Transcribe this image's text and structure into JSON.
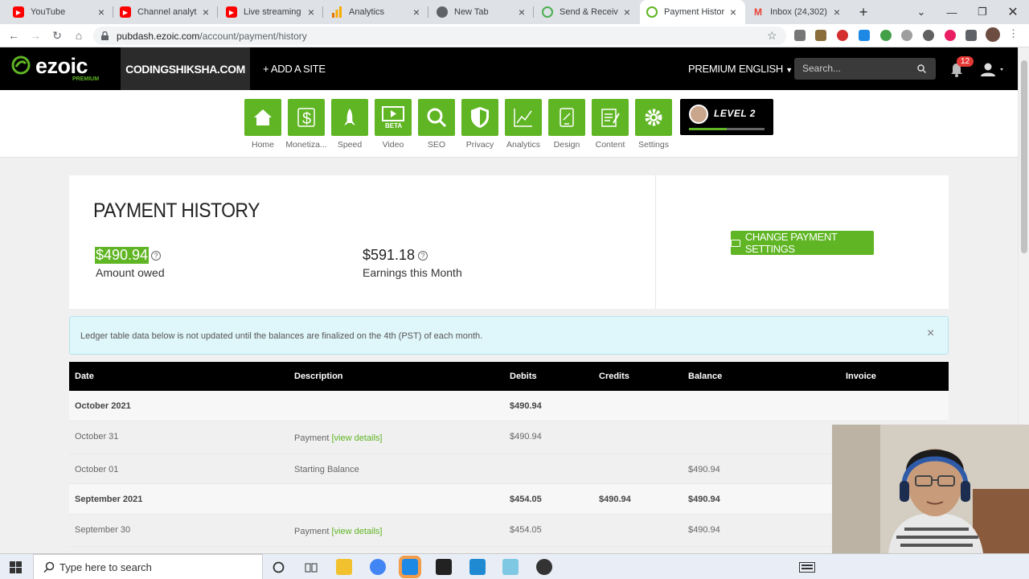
{
  "browser": {
    "tabs": [
      {
        "title": "YouTube",
        "favicon": "youtube-icon",
        "color": "#ff0000"
      },
      {
        "title": "Channel analytics",
        "favicon": "youtube-icon",
        "color": "#ff0000"
      },
      {
        "title": "Live streaming -",
        "favicon": "youtube-icon",
        "color": "#ff0000"
      },
      {
        "title": "Analytics",
        "favicon": "analytics-icon",
        "color": "#f9ab00"
      },
      {
        "title": "New Tab",
        "favicon": "chrome-icon",
        "color": "#5f6368"
      },
      {
        "title": "Send & Receive",
        "favicon": "circle-icon",
        "color": "#4caf50"
      },
      {
        "title": "Payment History",
        "favicon": "ezoic-icon",
        "color": "#5fb523"
      },
      {
        "title": "Inbox (24,302) -",
        "favicon": "gmail-icon",
        "color": "#ea4335"
      }
    ],
    "new_tab": "+",
    "url_domain": "pubdash.ezoic.com",
    "url_path": "/account/payment/history"
  },
  "header": {
    "logo": "ezoic",
    "logo_sub": "PREMIUM",
    "site": "CODINGSHIKSHA.COM",
    "add_site": "+ ADD A SITE",
    "premium": "PREMIUM",
    "language": "ENGLISH",
    "search_placeholder": "Search...",
    "notification_count": "12"
  },
  "nav": [
    {
      "label": "Home",
      "icon": "home-icon"
    },
    {
      "label": "Monetiza...",
      "icon": "dollar-icon"
    },
    {
      "label": "Speed",
      "icon": "rocket-icon"
    },
    {
      "label": "Video",
      "icon": "video-icon",
      "badge": "BETA"
    },
    {
      "label": "SEO",
      "icon": "magnifier-icon"
    },
    {
      "label": "Privacy",
      "icon": "shield-icon"
    },
    {
      "label": "Analytics",
      "icon": "chart-icon"
    },
    {
      "label": "Design",
      "icon": "design-icon"
    },
    {
      "label": "Content",
      "icon": "content-icon"
    },
    {
      "label": "Settings",
      "icon": "gear-icon"
    }
  ],
  "level": {
    "label": "LEVEL 2",
    "progress": 0.5
  },
  "summary": {
    "title": "PAYMENT HISTORY",
    "owed_value": "$490.94",
    "owed_label": "Amount owed",
    "earnings_value": "$591.18",
    "earnings_label": "Earnings this Month",
    "help": "?",
    "change_button": "CHANGE PAYMENT SETTINGS"
  },
  "alert": {
    "text": "Ledger table data below is not updated until the balances are finalized on the 4th (PST) of each month.",
    "close": "×"
  },
  "table": {
    "headers": [
      "Date",
      "Description",
      "Debits",
      "Credits",
      "Balance",
      "Invoice"
    ],
    "rows": [
      {
        "type": "month",
        "date": "October 2021",
        "description": "",
        "link": "",
        "debits": "$490.94",
        "credits": "",
        "balance": ""
      },
      {
        "type": "entry",
        "date": "October 31",
        "description": "Payment",
        "link": "[view details]",
        "debits": "$490.94",
        "credits": "",
        "balance": ""
      },
      {
        "type": "entry",
        "date": "October 01",
        "description": "Starting Balance",
        "link": "",
        "debits": "",
        "credits": "",
        "balance": "$490.94"
      },
      {
        "type": "month",
        "date": "September 2021",
        "description": "",
        "link": "",
        "debits": "$454.05",
        "credits": "$490.94",
        "balance": "$490.94"
      },
      {
        "type": "entry",
        "date": "September 30",
        "description": "Payment",
        "link": "[view details]",
        "debits": "$454.05",
        "credits": "",
        "balance": "$490.94"
      }
    ]
  },
  "taskbar": {
    "search_placeholder": "Type here to search"
  }
}
